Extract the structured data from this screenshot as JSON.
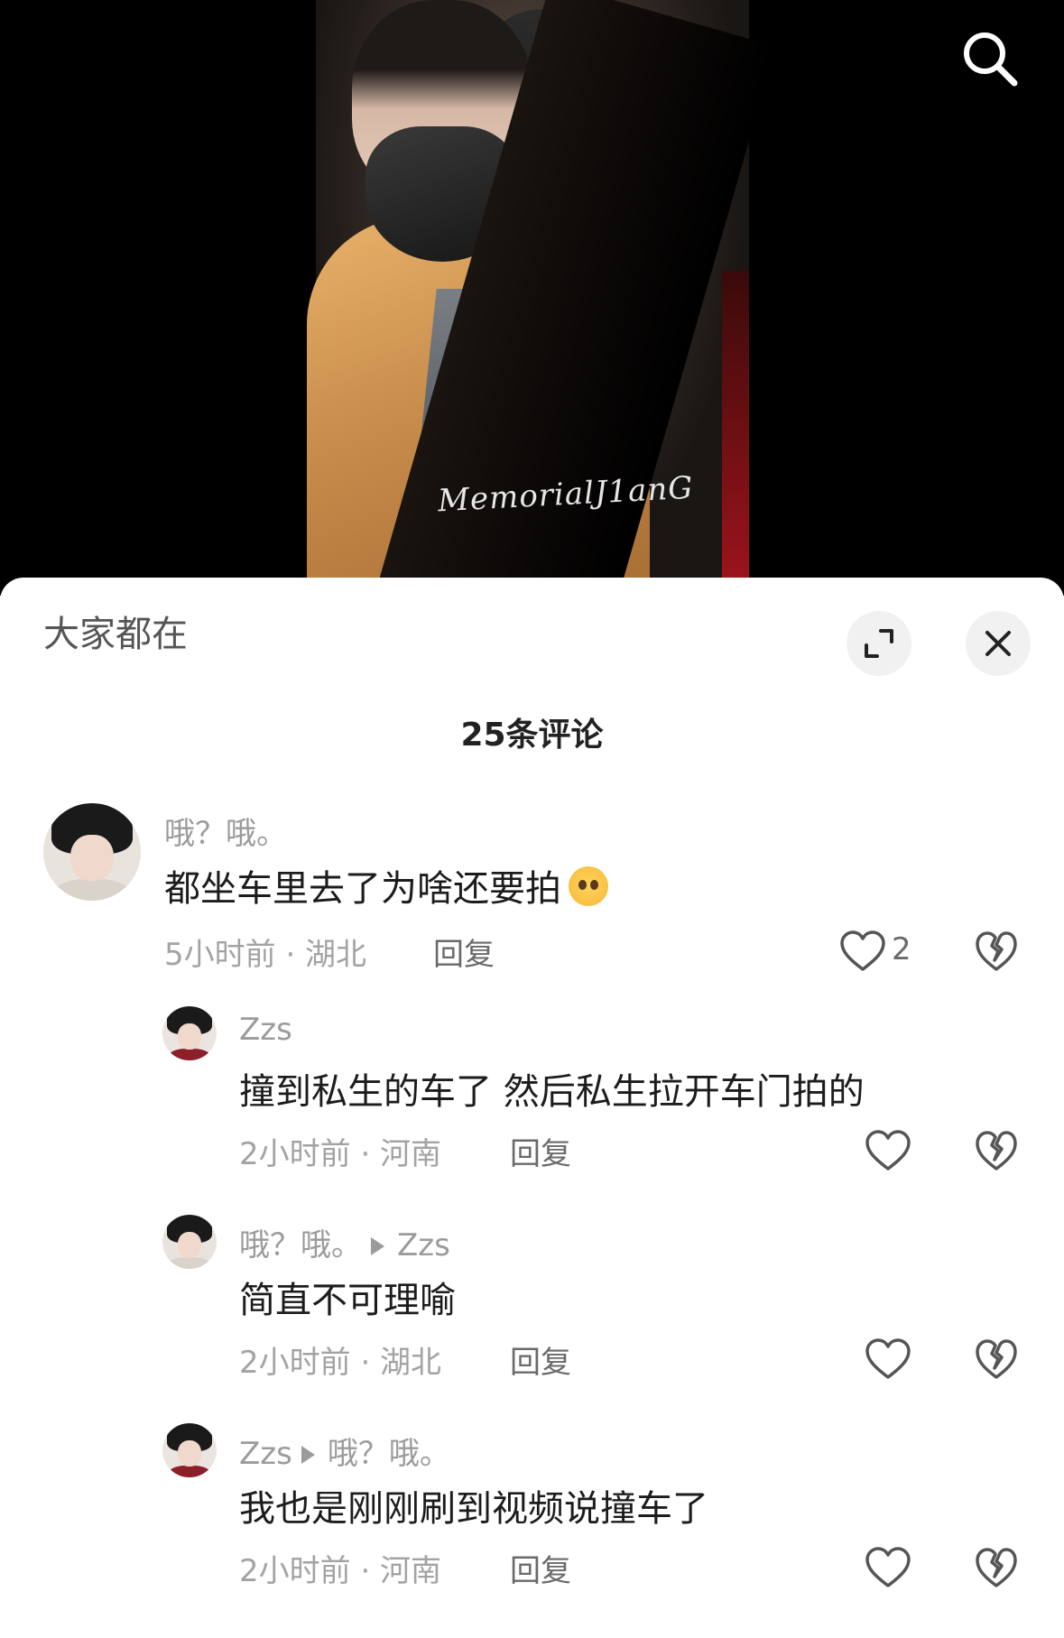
{
  "video": {
    "watermark": "MemorialJ1anG"
  },
  "header": {
    "ticker_text": "大家都在"
  },
  "comment_count_title": "25条评论",
  "comments": [
    {
      "user": "哦？哦。",
      "reply_to": "",
      "text": "都坐车里去了为啥还要拍",
      "emoji": "crying-face-emoji",
      "time": "5小时前",
      "location": "湖北",
      "meta": "5小时前 · 湖北",
      "reply_label": "回复",
      "likes": "2"
    },
    {
      "user": "Zzs",
      "reply_to": "",
      "text": "撞到私生的车了  然后私生拉开车门拍的",
      "time": "2小时前",
      "location": "河南",
      "meta": "2小时前 · 河南",
      "reply_label": "回复",
      "likes": ""
    },
    {
      "user": "哦？哦。",
      "reply_to": "Zzs",
      "text": "简直不可理喻",
      "time": "2小时前",
      "location": "湖北",
      "meta": "2小时前 · 湖北",
      "reply_label": "回复",
      "likes": ""
    },
    {
      "user": "Zzs",
      "reply_to": "哦？哦。",
      "text": "我也是刚刚刷到视频说撞车了",
      "time": "2小时前",
      "location": "河南",
      "meta": "2小时前 · 河南",
      "reply_label": "回复",
      "likes": ""
    }
  ],
  "icons": {
    "search": "search-icon",
    "expand": "expand-icon",
    "close": "close-icon",
    "like": "heart-outline-icon",
    "dislike": "broken-heart-icon"
  },
  "colors": {
    "sheet_background": "#ffffff",
    "video_background": "#000000",
    "secondary_text": "#9b9b9b"
  }
}
